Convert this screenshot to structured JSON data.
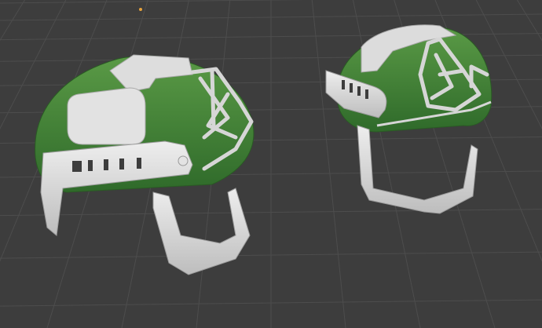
{
  "viewport": {
    "background": "#3d3d3d",
    "grid_line_color": "#4d4d4d",
    "origin_marker_color": "#e6a23c"
  },
  "models": [
    {
      "name": "helmet-left",
      "shell_color": "#4a8a3a",
      "rail_color": "#d9d9d9",
      "shading_color": "#2f5f28"
    },
    {
      "name": "helmet-right",
      "shell_color": "#4a8a3a",
      "rail_color": "#d9d9d9",
      "shading_color": "#2f5f28"
    }
  ]
}
